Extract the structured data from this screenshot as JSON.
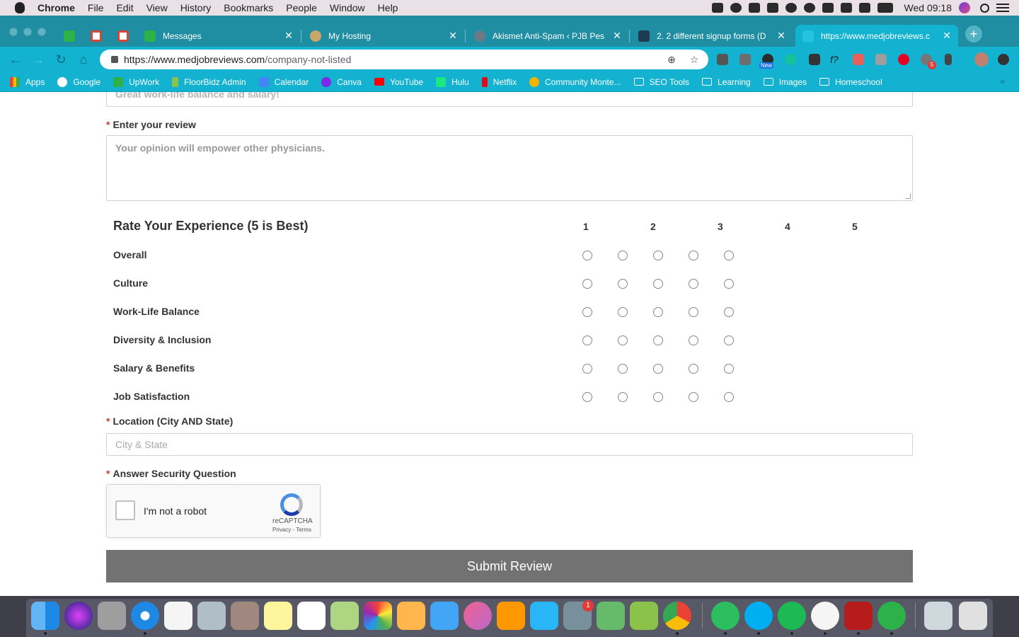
{
  "menubar": {
    "app": "Chrome",
    "items": [
      "File",
      "Edit",
      "View",
      "History",
      "Bookmarks",
      "People",
      "Window",
      "Help"
    ],
    "clock": "Wed 09:18"
  },
  "tabs": [
    {
      "title": "",
      "favicon_color": "#2db24a"
    },
    {
      "title": "",
      "favicon_color": "#d44638"
    },
    {
      "title": "",
      "favicon_color": "#d44638"
    },
    {
      "title": "Messages",
      "favicon_color": "#2db24a"
    },
    {
      "title": "My Hosting",
      "favicon_color": "#c9a66b"
    },
    {
      "title": "Akismet Anti-Spam ‹ PJB Pes",
      "favicon_color": "#6b7a85"
    },
    {
      "title": "2. 2 different signup forms (D",
      "favicon_color": "#1d3b53"
    },
    {
      "title": "https://www.medjobreviews.c",
      "favicon_color": "#25c3e0"
    }
  ],
  "address": {
    "domain": "https://www.medjobreviews.com",
    "path": "/company-not-listed"
  },
  "extensions": {
    "new_badge": "New",
    "notif_count": "5"
  },
  "bookmarks": [
    {
      "label": "Apps",
      "color": "#e94235",
      "icon": "apps-icon"
    },
    {
      "label": "Google",
      "color": "#ffffff",
      "icon": "google-icon"
    },
    {
      "label": "UpWork",
      "color": "#2db24a",
      "icon": "upwork-icon"
    },
    {
      "label": "FloorBidz Admin",
      "color": "#8bc34a",
      "icon": "floorbidz-icon"
    },
    {
      "label": "Calendar",
      "color": "#4285f4",
      "icon": "calendar-icon"
    },
    {
      "label": "Canva",
      "color": "#7d2ae8",
      "icon": "canva-icon"
    },
    {
      "label": "YouTube",
      "color": "#ff0000",
      "icon": "youtube-icon"
    },
    {
      "label": "Hulu",
      "color": "#1ce783",
      "icon": "hulu-icon"
    },
    {
      "label": "Netflix",
      "color": "#e50914",
      "icon": "netflix-icon"
    },
    {
      "label": "Community Monte...",
      "color": "#f4b400",
      "icon": "community-icon"
    },
    {
      "label": "SEO Tools",
      "color": "",
      "icon": "folder-icon"
    },
    {
      "label": "Learning",
      "color": "",
      "icon": "folder-icon"
    },
    {
      "label": "Images",
      "color": "",
      "icon": "folder-icon"
    },
    {
      "label": "Homeschool",
      "color": "",
      "icon": "folder-icon"
    }
  ],
  "form": {
    "headline_placeholder": "Great work-life balance and salary!",
    "review_label": "Enter your review",
    "review_placeholder": "Your opinion will empower other physicians.",
    "rating_title": "Rate Your Experience (5 is Best)",
    "rating_columns": [
      "1",
      "2",
      "3",
      "4",
      "5"
    ],
    "rating_rows": [
      "Overall",
      "Culture",
      "Work-Life Balance",
      "Diversity & Inclusion",
      "Salary & Benefits",
      "Job Satisfaction"
    ],
    "location_label": "Location (City AND State)",
    "location_placeholder": "City & State",
    "security_label": "Answer Security Question",
    "required_mark": "*",
    "recaptcha_text": "I'm not a robot",
    "recaptcha_brand": "reCAPTCHA",
    "recaptcha_links": "Privacy - Terms",
    "submit_label": "Submit Review"
  },
  "dock": {
    "badge_count": "1"
  }
}
